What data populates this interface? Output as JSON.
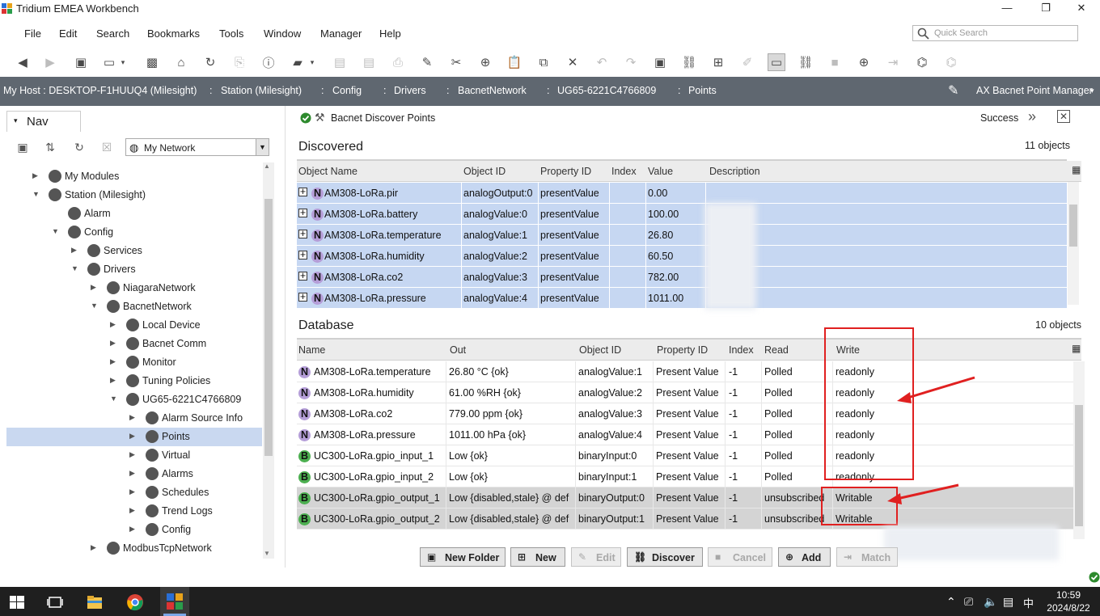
{
  "window": {
    "title": "Tridium EMEA Workbench",
    "minimize": "—",
    "maximize": "❐",
    "close": "✕"
  },
  "menu": {
    "items": [
      "File",
      "Edit",
      "Search",
      "Bookmarks",
      "Tools",
      "Window",
      "Manager",
      "Help"
    ],
    "quick_search_placeholder": "Quick Search"
  },
  "locator": {
    "host": "My Host : DESKTOP-F1HUUQ4 (Milesight)",
    "station": "Station (Milesight)",
    "config": "Config",
    "drivers": "Drivers",
    "network": "BacnetNetwork",
    "device": "UG65-6221C4766809",
    "points": "Points",
    "view": "AX Bacnet Point Manager"
  },
  "nav": {
    "tab_label": "Nav",
    "network_select": "My Network",
    "tree": [
      {
        "label": "My Modules",
        "level": 1,
        "state": "collapsed"
      },
      {
        "label": "Station (Milesight)",
        "level": 1,
        "state": "expanded"
      },
      {
        "label": "Alarm",
        "level": 2,
        "state": "leaf"
      },
      {
        "label": "Config",
        "level": 2,
        "state": "expanded"
      },
      {
        "label": "Services",
        "level": 3,
        "state": "collapsed"
      },
      {
        "label": "Drivers",
        "level": 3,
        "state": "expanded"
      },
      {
        "label": "NiagaraNetwork",
        "level": 4,
        "state": "collapsed"
      },
      {
        "label": "BacnetNetwork",
        "level": 4,
        "state": "expanded"
      },
      {
        "label": "Local Device",
        "level": 5,
        "state": "collapsed"
      },
      {
        "label": "Bacnet Comm",
        "level": 5,
        "state": "collapsed"
      },
      {
        "label": "Monitor",
        "level": 5,
        "state": "collapsed"
      },
      {
        "label": "Tuning Policies",
        "level": 5,
        "state": "collapsed"
      },
      {
        "label": "UG65-6221C4766809",
        "level": 5,
        "state": "expanded"
      },
      {
        "label": "Alarm Source Info",
        "level": 6,
        "state": "collapsed"
      },
      {
        "label": "Points",
        "level": 6,
        "state": "collapsed",
        "selected": true
      },
      {
        "label": "Virtual",
        "level": 6,
        "state": "collapsed"
      },
      {
        "label": "Alarms",
        "level": 6,
        "state": "collapsed"
      },
      {
        "label": "Schedules",
        "level": 6,
        "state": "collapsed"
      },
      {
        "label": "Trend Logs",
        "level": 6,
        "state": "collapsed"
      },
      {
        "label": "Config",
        "level": 6,
        "state": "collapsed"
      },
      {
        "label": "ModbusTcpNetwork",
        "level": 4,
        "state": "collapsed"
      }
    ]
  },
  "job": {
    "title": "Bacnet Discover Points",
    "status": "Success"
  },
  "discovered": {
    "tab": "Discovered",
    "count": "11 objects",
    "columns": [
      "Object Name",
      "Object ID",
      "Property ID",
      "Index",
      "Value",
      "Description"
    ],
    "rows": [
      {
        "name": "AM308-LoRa.pir",
        "object_id": "analogOutput:0",
        "property": "presentValue",
        "index": "",
        "value": "0.00"
      },
      {
        "name": "AM308-LoRa.battery",
        "object_id": "analogValue:0",
        "property": "presentValue",
        "index": "",
        "value": "100.00"
      },
      {
        "name": "AM308-LoRa.temperature",
        "object_id": "analogValue:1",
        "property": "presentValue",
        "index": "",
        "value": "26.80"
      },
      {
        "name": "AM308-LoRa.humidity",
        "object_id": "analogValue:2",
        "property": "presentValue",
        "index": "",
        "value": "60.50"
      },
      {
        "name": "AM308-LoRa.co2",
        "object_id": "analogValue:3",
        "property": "presentValue",
        "index": "",
        "value": "782.00"
      },
      {
        "name": "AM308-LoRa.pressure",
        "object_id": "analogValue:4",
        "property": "presentValue",
        "index": "",
        "value": "1011.00"
      }
    ]
  },
  "database": {
    "tab": "Database",
    "count": "10 objects",
    "columns": [
      "Name",
      "Out",
      "Object ID",
      "Property ID",
      "Index",
      "Read",
      "Write"
    ],
    "rows": [
      {
        "type": "N",
        "name": "AM308-LoRa.temperature",
        "out": "26.80 °C {ok}",
        "object_id": "analogValue:1",
        "property": "Present Value",
        "index": "-1",
        "read": "Polled",
        "write": "readonly",
        "grey": false
      },
      {
        "type": "N",
        "name": "AM308-LoRa.humidity",
        "out": "61.00 %RH {ok}",
        "object_id": "analogValue:2",
        "property": "Present Value",
        "index": "-1",
        "read": "Polled",
        "write": "readonly",
        "grey": false
      },
      {
        "type": "N",
        "name": "AM308-LoRa.co2",
        "out": "779.00 ppm {ok}",
        "object_id": "analogValue:3",
        "property": "Present Value",
        "index": "-1",
        "read": "Polled",
        "write": "readonly",
        "grey": false
      },
      {
        "type": "N",
        "name": "AM308-LoRa.pressure",
        "out": "1011.00 hPa {ok}",
        "object_id": "analogValue:4",
        "property": "Present Value",
        "index": "-1",
        "read": "Polled",
        "write": "readonly",
        "grey": false
      },
      {
        "type": "B",
        "name": "UC300-LoRa.gpio_input_1",
        "out": "Low {ok}",
        "object_id": "binaryInput:0",
        "property": "Present Value",
        "index": "-1",
        "read": "Polled",
        "write": "readonly",
        "grey": false
      },
      {
        "type": "B",
        "name": "UC300-LoRa.gpio_input_2",
        "out": "Low {ok}",
        "object_id": "binaryInput:1",
        "property": "Present Value",
        "index": "-1",
        "read": "Polled",
        "write": "readonly",
        "grey": false
      },
      {
        "type": "B",
        "name": "UC300-LoRa.gpio_output_1",
        "out": "Low {disabled,stale} @ def",
        "object_id": "binaryOutput:0",
        "property": "Present Value",
        "index": "-1",
        "read": "unsubscribed",
        "write": "Writable",
        "grey": true
      },
      {
        "type": "B",
        "name": "UC300-LoRa.gpio_output_2",
        "out": "Low {disabled,stale} @ def",
        "object_id": "binaryOutput:1",
        "property": "Present Value",
        "index": "-1",
        "read": "unsubscribed",
        "write": "Writable",
        "grey": true
      }
    ]
  },
  "buttons": {
    "new_folder": "New Folder",
    "new": "New",
    "edit": "Edit",
    "discover": "Discover",
    "cancel": "Cancel",
    "add": "Add",
    "match": "Match"
  },
  "taskbar": {
    "time": "10:59",
    "date": "2024/8/22",
    "ime": "中"
  },
  "colors": {
    "accent_blue": "#c6d7f2",
    "locator_bg": "#5f6770",
    "annotation_red": "#e02020"
  }
}
